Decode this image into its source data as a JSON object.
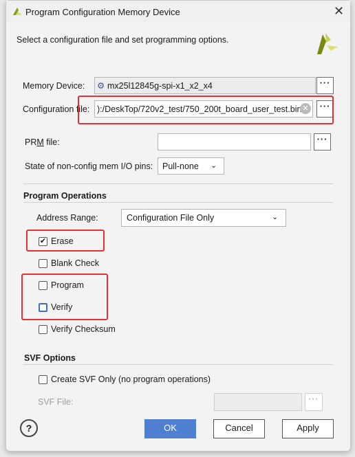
{
  "window": {
    "title": "Program Configuration Memory Device",
    "close": "✕"
  },
  "header": {
    "description": "Select a configuration file and set programming options."
  },
  "memory_device": {
    "label": "Memory Device:",
    "value": "mx25l12845g-spi-x1_x2_x4"
  },
  "config_file": {
    "label": "Configuration file:",
    "value": "):/DeskTop/720v2_test/750_200t_board_user_test.bin"
  },
  "prm_file": {
    "label": "PRM file:",
    "value": ""
  },
  "pin_state": {
    "label": "State of non-config mem I/O pins:",
    "value": "Pull-none"
  },
  "program_operations": {
    "heading": "Program Operations",
    "address_range_label": "Address Range:",
    "address_range_value": "Configuration File Only",
    "options": [
      {
        "label": "Erase",
        "checked": true
      },
      {
        "label": "Blank Check",
        "checked": false
      },
      {
        "label": "Program",
        "checked": false
      },
      {
        "label": "Verify",
        "checked": false
      },
      {
        "label": "Verify Checksum",
        "checked": false
      }
    ]
  },
  "svf_options": {
    "heading": "SVF Options",
    "create_svf_label": "Create SVF Only (no program operations)",
    "create_svf_checked": false,
    "svf_file_label": "SVF File:",
    "svf_file_value": ""
  },
  "buttons": {
    "help": "?",
    "ok": "OK",
    "cancel": "Cancel",
    "apply": "Apply",
    "browse": "···"
  },
  "colors": {
    "ok_button": "#4f7fd0",
    "highlight_box": "#e53030",
    "focus_checkbox": "#3d6fc9"
  }
}
